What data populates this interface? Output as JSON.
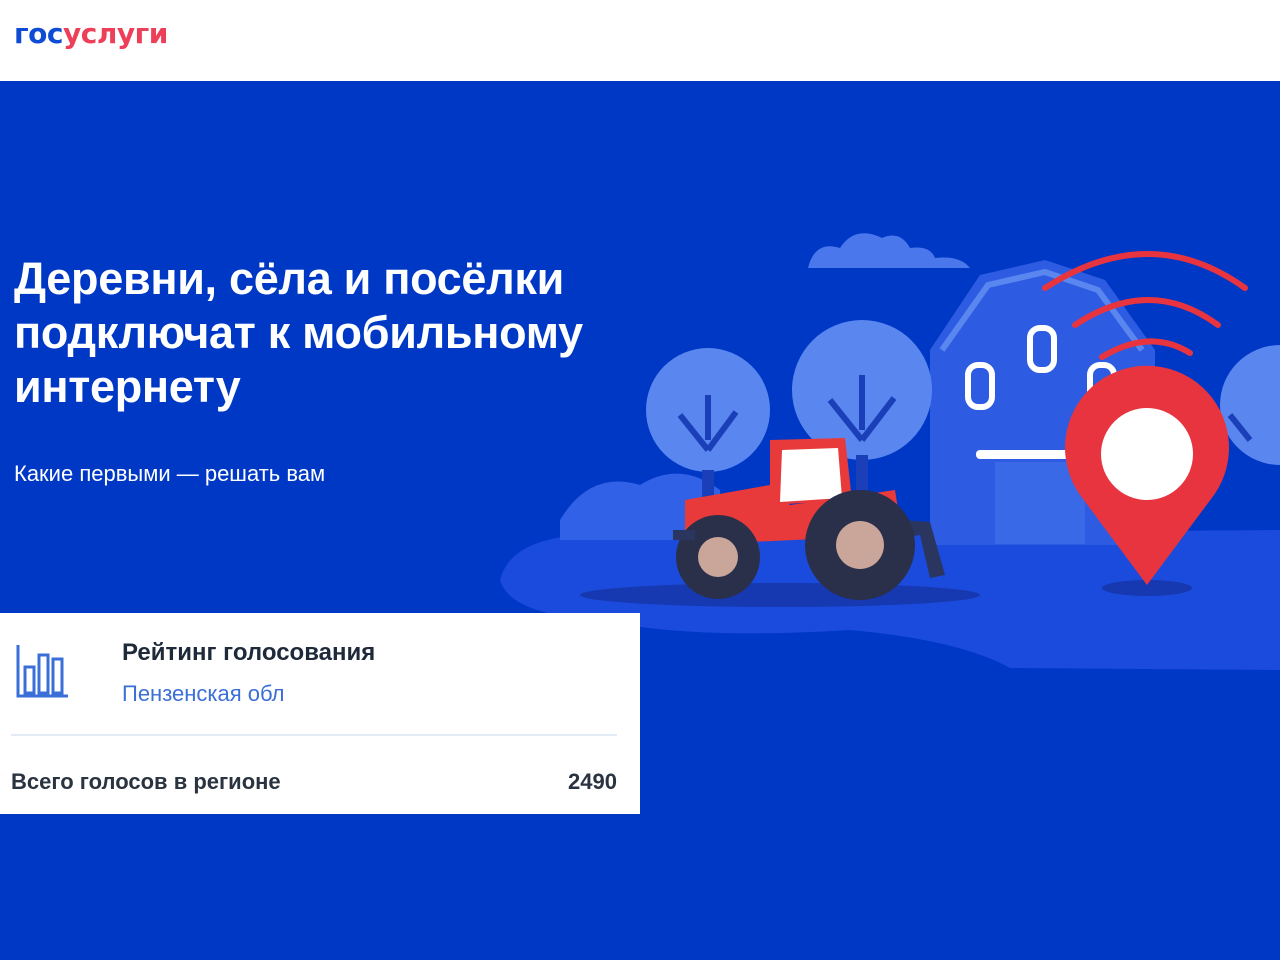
{
  "header": {
    "logo_part1": "гос",
    "logo_part2": "услуги",
    "logo_colors": {
      "part1": "#0d4cd3",
      "part2": "#ee3f58"
    }
  },
  "hero": {
    "title": "Деревни, сёла и посёлки подключат к мобильному интернету",
    "subtitle": "Какие первыми — решать вам",
    "background_color": "#0038c6"
  },
  "illustration": {
    "icons": [
      "cloud-icon",
      "barn-icon",
      "tree-icon",
      "tractor-icon",
      "location-pin-icon",
      "wifi-signal-icon"
    ]
  },
  "rating_card": {
    "icon": "bar-chart-icon",
    "title": "Рейтинг голосования",
    "region": "Пензенская обл",
    "votes_label": "Всего голосов в регионе",
    "votes_value": "2490"
  }
}
